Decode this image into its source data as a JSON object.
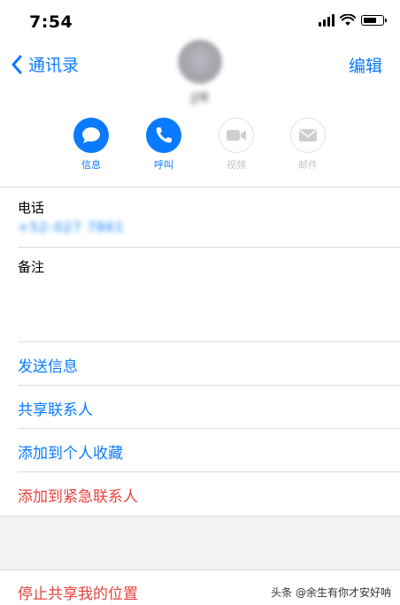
{
  "status_bar": {
    "time": "7:54"
  },
  "nav": {
    "back_label": "通讯录",
    "edit_label": "编辑"
  },
  "contact": {
    "name": "JJ琴"
  },
  "actions": [
    {
      "label": "信息",
      "icon": "message-icon",
      "enabled": true
    },
    {
      "label": "呼叫",
      "icon": "phone-icon",
      "enabled": true
    },
    {
      "label": "视频",
      "icon": "video-icon",
      "enabled": false
    },
    {
      "label": "邮件",
      "icon": "mail-icon",
      "enabled": false
    }
  ],
  "phone": {
    "label": "电话",
    "value": "+52-027 7861"
  },
  "notes": {
    "label": "备注"
  },
  "links": {
    "send_message": "发送信息",
    "share_contact": "共享联系人",
    "add_favorites": "添加到个人收藏",
    "add_emergency": "添加到紧急联系人",
    "stop_sharing": "停止共享我的位置"
  },
  "watermark": "头条 @余生有你才安好呐",
  "colors": {
    "accent": "#0a7aff",
    "destructive": "#e64340",
    "separator": "#dcdcdf",
    "group_bg": "#f2f2f4"
  }
}
